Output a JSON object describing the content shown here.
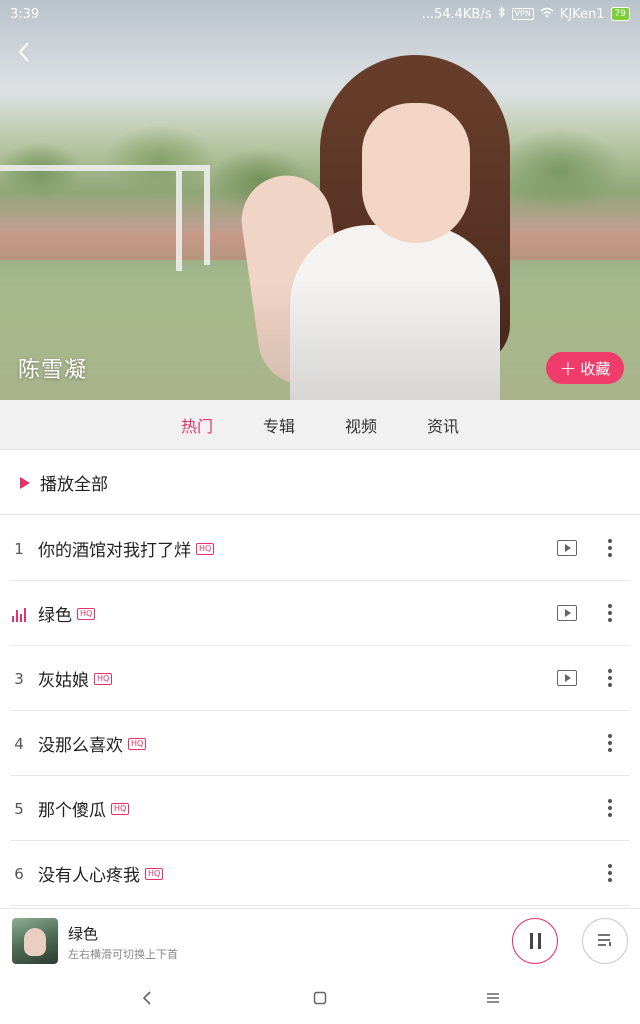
{
  "status_bar": {
    "time": "3:39",
    "network_speed": "...54.4KB/s",
    "vpn": "VPN",
    "wifi_name": "KJKen1",
    "battery": "79"
  },
  "hero": {
    "artist_name": "陈雪凝",
    "favorite_label": "收藏",
    "favorite_icon": "+"
  },
  "tabs": [
    {
      "label": "热门",
      "active": true
    },
    {
      "label": "专辑",
      "active": false
    },
    {
      "label": "视频",
      "active": false
    },
    {
      "label": "资讯",
      "active": false
    }
  ],
  "play_all_label": "播放全部",
  "hq_badge": "HQ",
  "songs": [
    {
      "index": "1",
      "title": "你的酒馆对我打了烊",
      "hq": true,
      "has_mv": true,
      "playing": false
    },
    {
      "index": "",
      "title": "绿色",
      "hq": true,
      "has_mv": true,
      "playing": true
    },
    {
      "index": "3",
      "title": "灰姑娘",
      "hq": true,
      "has_mv": true,
      "playing": false
    },
    {
      "index": "4",
      "title": "没那么喜欢",
      "hq": true,
      "has_mv": false,
      "playing": false
    },
    {
      "index": "5",
      "title": "那个傻瓜",
      "hq": true,
      "has_mv": false,
      "playing": false
    },
    {
      "index": "6",
      "title": "没有人心疼我",
      "hq": true,
      "has_mv": false,
      "playing": false
    }
  ],
  "player": {
    "title": "绿色",
    "hint": "左右横滑可切换上下首"
  },
  "colors": {
    "accent": "#e4336b",
    "fav_button": "#ef3c6a"
  },
  "icons": {
    "back": "back-chevron-icon",
    "mv": "video-play-icon",
    "more": "more-vertical-icon",
    "pause": "pause-icon",
    "queue": "playlist-icon",
    "nav_back": "nav-back-icon",
    "nav_home": "nav-home-icon",
    "nav_menu": "nav-menu-icon"
  }
}
